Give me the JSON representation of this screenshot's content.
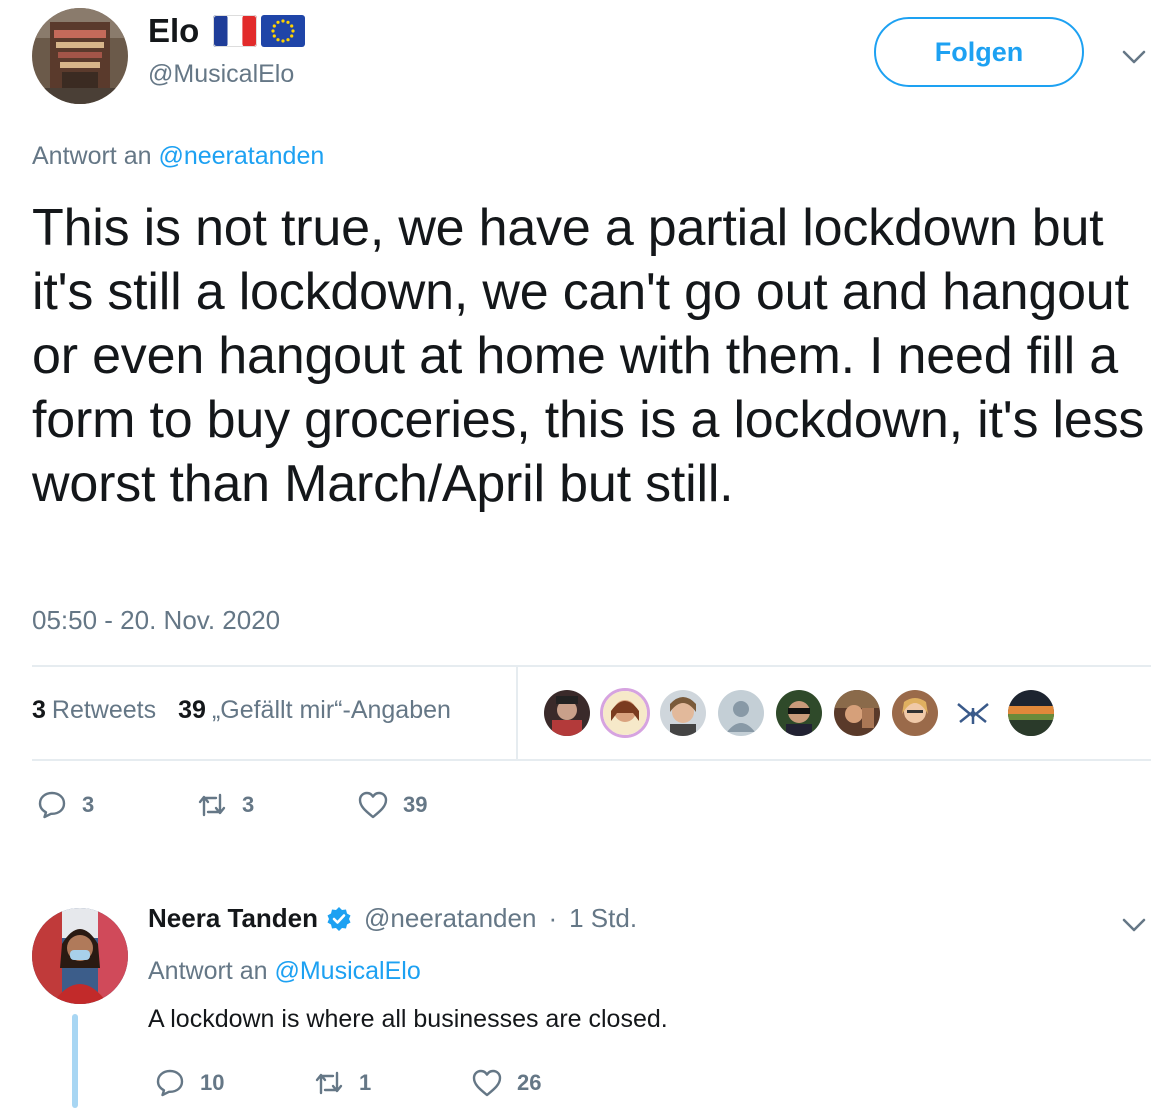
{
  "tweet": {
    "author_name": "Elo",
    "author_handle": "@MusicalElo",
    "follow_label": "Folgen",
    "reply_prefix": "Antwort an",
    "reply_to_handle": "@neeratanden",
    "text": "This is not true, we have a partial lockdown but it's still a lockdown, we can't go out and hangout or even hangout at home with them. I need fill a form to buy groceries, this is a lockdown, it's less worst than March/April but still.",
    "timestamp": "05:50 - 20. Nov. 2020",
    "retweets_count": "3",
    "retweets_label": "Retweets",
    "likes_count": "39",
    "likes_label": "„Gefällt mir“-Angaben",
    "actions": {
      "replies": "3",
      "retweets": "3",
      "likes": "39"
    },
    "flag_icons": [
      "france-flag-icon",
      "eu-flag-icon"
    ]
  },
  "reply": {
    "author_name": "Neera Tanden",
    "author_handle": "@neeratanden",
    "separator": "·",
    "time": "1 Std.",
    "verified_icon": "verified-badge-icon",
    "reply_prefix": "Antwort an",
    "reply_to_handle": "@MusicalElo",
    "text": "A lockdown is where all businesses are closed.",
    "actions": {
      "replies": "10",
      "retweets": "1",
      "likes": "26"
    }
  },
  "colors": {
    "accent": "#1da1f2",
    "text_primary": "#14171a",
    "text_secondary": "#657786",
    "divider": "#e6ecf0",
    "thread_line": "#a8d6f3"
  }
}
